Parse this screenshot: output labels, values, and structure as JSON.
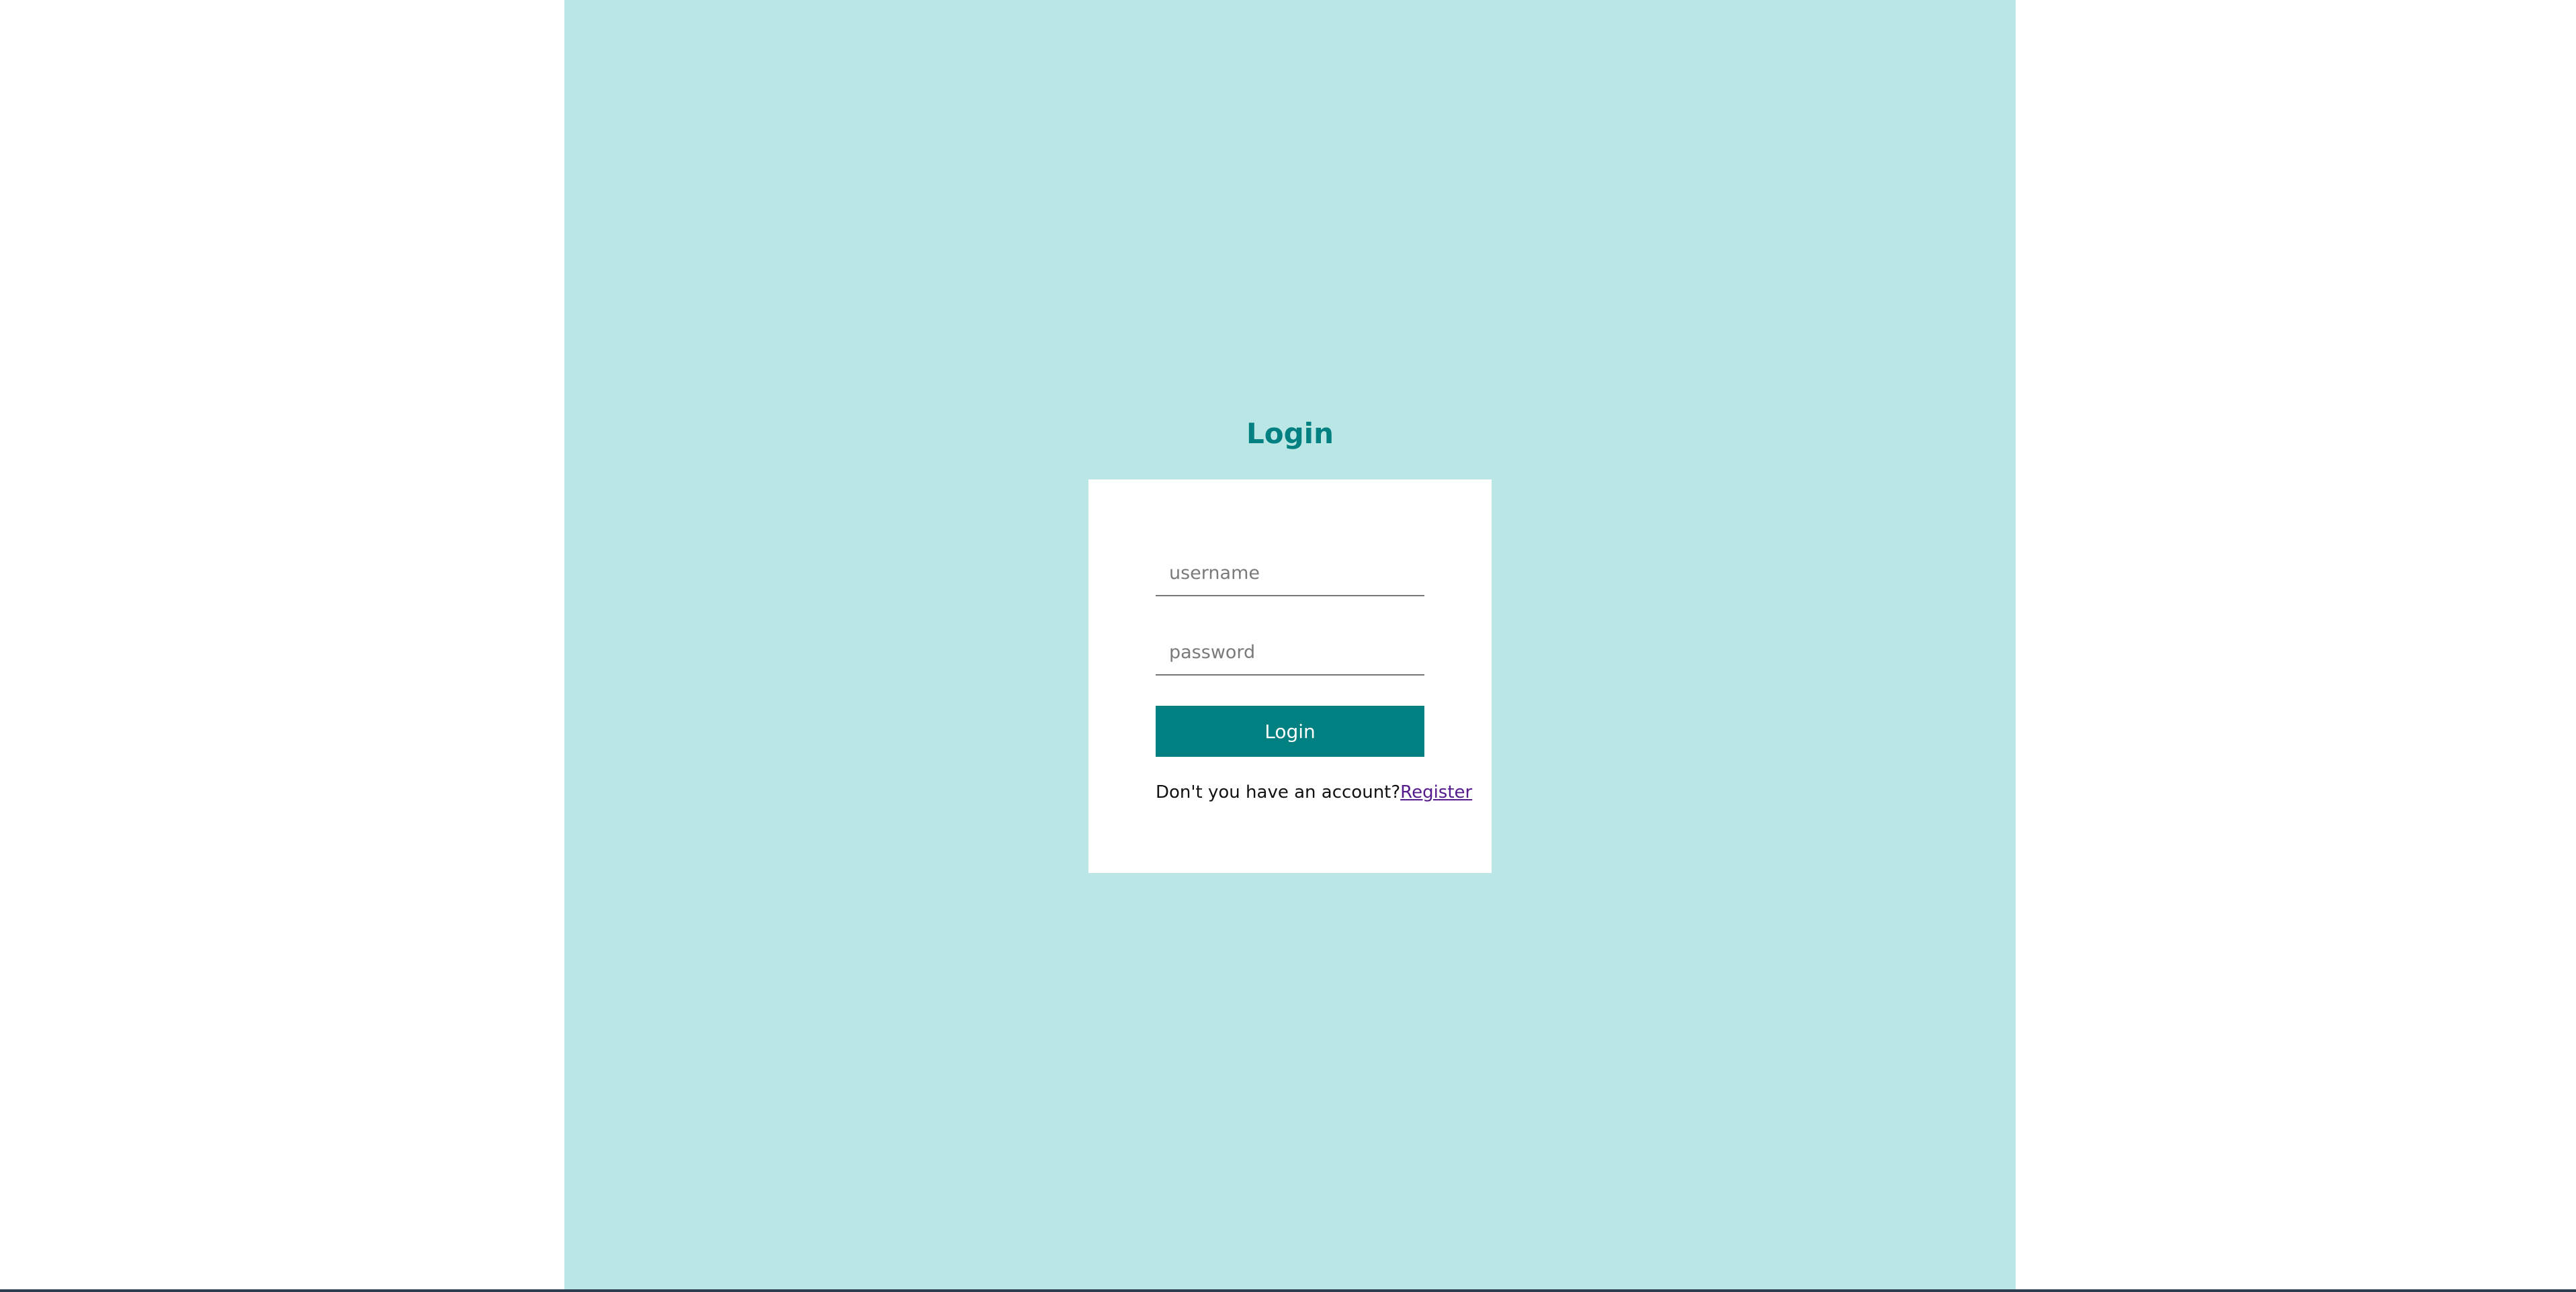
{
  "login": {
    "title": "Login",
    "username_placeholder": "username",
    "password_placeholder": "password",
    "submit_label": "Login",
    "no_account_text": "Don't you have an account?",
    "register_link": "Register"
  },
  "colors": {
    "background": "#bbe6e6",
    "accent": "#008080",
    "card": "#ffffff",
    "link": "#551a8b"
  }
}
